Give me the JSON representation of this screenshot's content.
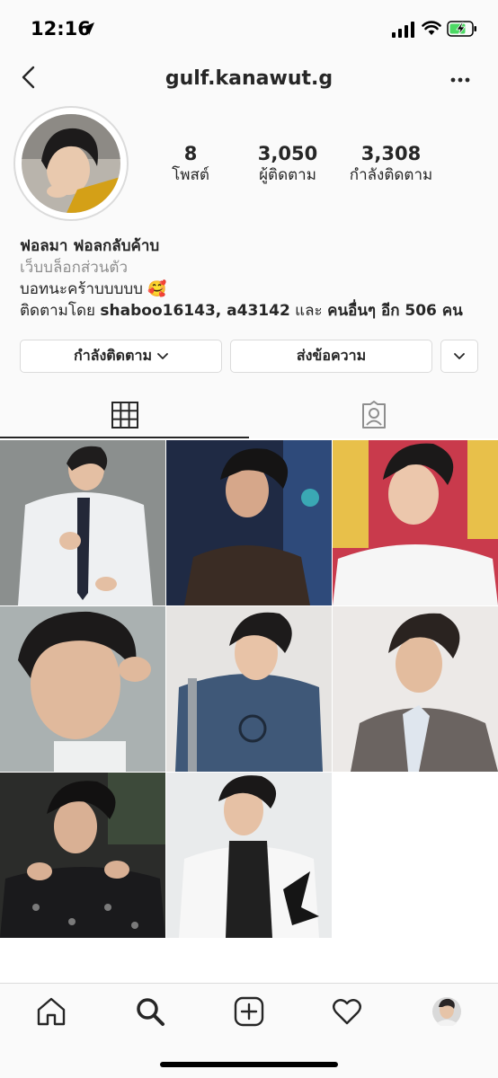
{
  "status_bar": {
    "time": "12:16",
    "icons": [
      "location-arrow-icon",
      "signal-icon",
      "wifi-icon",
      "battery-charging-icon"
    ]
  },
  "header": {
    "username": "gulf.kanawut.g",
    "icons": [
      "back-chevron-icon",
      "more-dots-icon"
    ]
  },
  "profile": {
    "stats": {
      "posts": {
        "value": "8",
        "label": "โพสต์"
      },
      "followers": {
        "value": "3,050",
        "label": "ผู้ติดตาม"
      },
      "following": {
        "value": "3,308",
        "label": "กำลังติดตาม"
      }
    },
    "name": "ฟอลมา ฟอลกลับค้าบ",
    "category": "เว็บบล็อกส่วนตัว",
    "bio_text": "บอทนะคร้าบบบบบ 🥰",
    "followed_by": {
      "prefix": "ติดตามโดย ",
      "accounts": "shaboo16143, a43142",
      "middle": " และ ",
      "others": "คนอื่นๆ อีก 506 คน"
    }
  },
  "actions": {
    "following_label": "กำลังติดตาม",
    "message_label": "ส่งข้อความ"
  },
  "tabs": [
    "grid-icon",
    "tagged-person-icon"
  ],
  "grid_photos": [
    {
      "description": "man in white shirt with tie, grey background"
    },
    {
      "description": "man in dark shirt, blue lit background"
    },
    {
      "description": "man in white shirt, red backdrop"
    },
    {
      "description": "close-up face, hand on chin"
    },
    {
      "description": "man in blue hoodie with bag"
    },
    {
      "description": "man in grey suit jacket"
    },
    {
      "description": "man in patterned jacket, dark background"
    },
    {
      "description": "man in white jacket and black turtleneck"
    }
  ],
  "bottom_nav": [
    "home-icon",
    "search-icon",
    "new-post-icon",
    "activity-heart-icon",
    "profile-avatar-icon"
  ],
  "colors": {
    "text": "#262626",
    "secondary": "#8e8e8e",
    "border": "#dbdbdb",
    "background": "#fafafa"
  }
}
